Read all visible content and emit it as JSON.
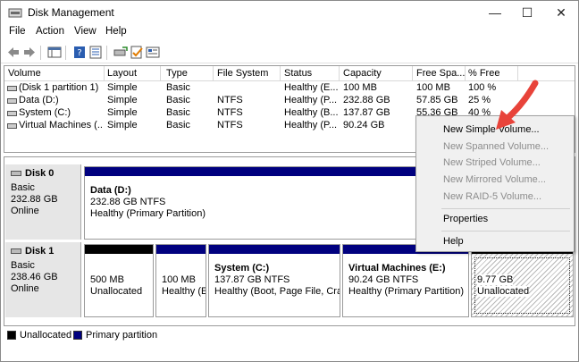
{
  "window": {
    "title": "Disk Management",
    "min_glyph": "—",
    "max_glyph": "☐",
    "close_glyph": "✕"
  },
  "menu": [
    "File",
    "Action",
    "View",
    "Help"
  ],
  "volume_list": {
    "headers": [
      "Volume",
      "Layout",
      "Type",
      "File System",
      "Status",
      "Capacity",
      "Free Spa...",
      "% Free"
    ],
    "rows": [
      [
        "(Disk 1 partition 1)",
        "Simple",
        "Basic",
        "",
        "Healthy (E...",
        "100 MB",
        "100 MB",
        "100 %"
      ],
      [
        "Data (D:)",
        "Simple",
        "Basic",
        "NTFS",
        "Healthy (P...",
        "232.88 GB",
        "57.85 GB",
        "25 %"
      ],
      [
        "System (C:)",
        "Simple",
        "Basic",
        "NTFS",
        "Healthy (B...",
        "137.87 GB",
        "55.36 GB",
        "40 %"
      ],
      [
        "Virtual Machines (...",
        "Simple",
        "Basic",
        "NTFS",
        "Healthy (P...",
        "90.24 GB",
        "",
        ""
      ]
    ]
  },
  "disks": {
    "disk0": {
      "name": "Disk 0",
      "type": "Basic",
      "size": "232.88 GB",
      "status": "Online",
      "partition": {
        "title": "Data  (D:)",
        "size": "232.88 GB NTFS",
        "status": "Healthy (Primary Partition)"
      }
    },
    "disk1": {
      "name": "Disk 1",
      "type": "Basic",
      "size": "238.46 GB",
      "status": "Online",
      "partitions": [
        {
          "size": "500 MB",
          "status": "Unallocated"
        },
        {
          "size": "100 MB",
          "status": "Healthy (E"
        },
        {
          "title": "System  (C:)",
          "size": "137.87 GB NTFS",
          "status": "Healthy (Boot, Page File, Crash"
        },
        {
          "title": "Virtual Machines  (E:)",
          "size": "90.24 GB NTFS",
          "status": "Healthy (Primary Partition)"
        },
        {
          "size": "9.77 GB",
          "status": "Unallocated"
        }
      ]
    }
  },
  "legend": {
    "unallocated": "Unallocated",
    "primary": "Primary partition"
  },
  "context_menu": {
    "new_simple": "New Simple Volume...",
    "new_spanned": "New Spanned Volume...",
    "new_striped": "New Striped Volume...",
    "new_mirrored": "New Mirrored Volume...",
    "new_raid5": "New RAID-5 Volume...",
    "properties": "Properties",
    "help": "Help"
  },
  "colors": {
    "primary": "#00007f",
    "unallocated": "#000000",
    "arrow": "#e8433a"
  }
}
